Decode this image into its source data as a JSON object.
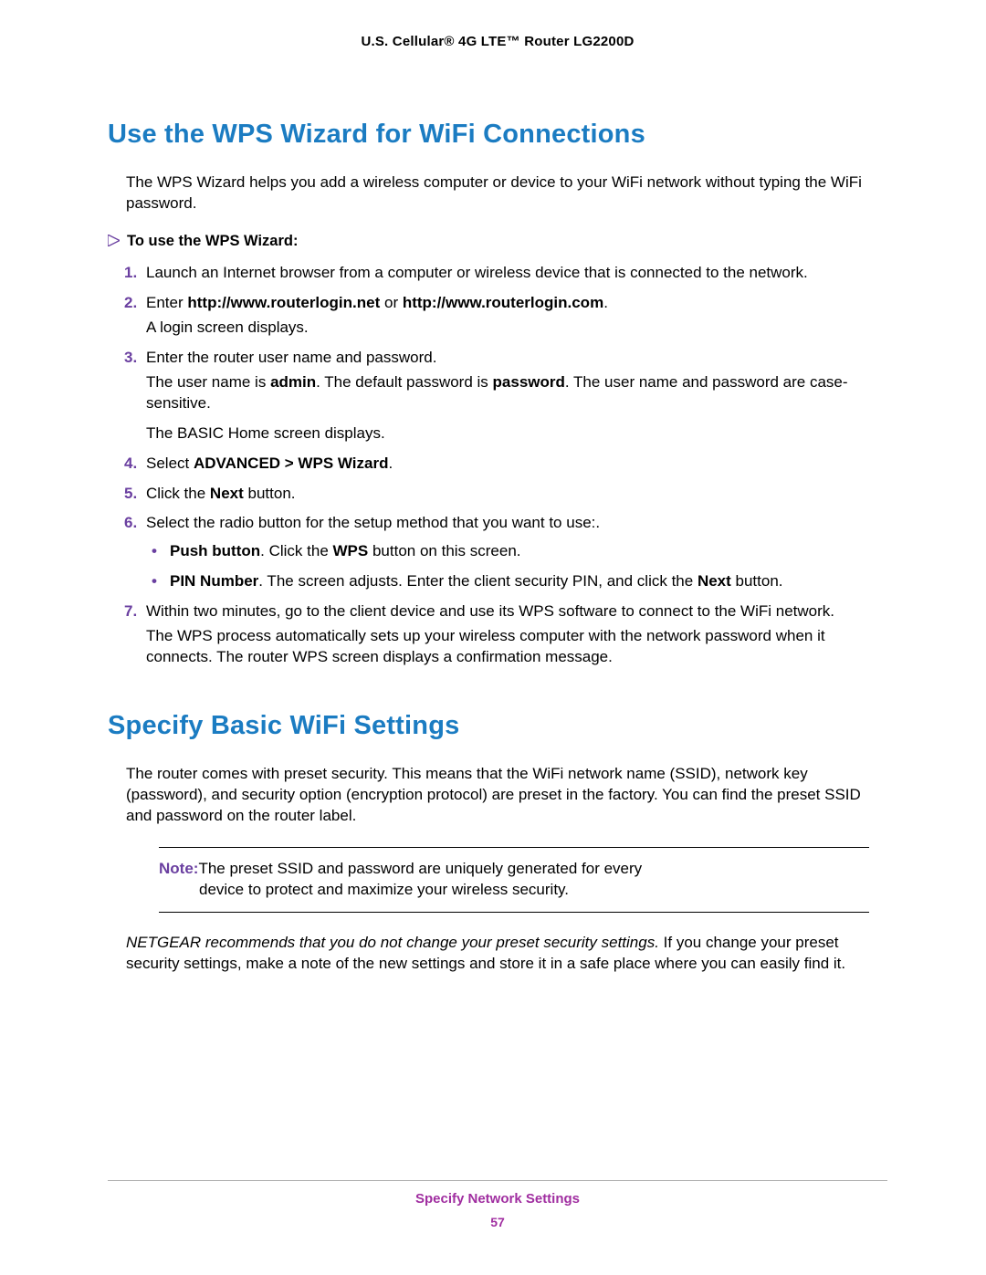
{
  "header": "U.S. Cellular® 4G LTE™ Router LG2200D",
  "section1": {
    "heading": "Use the WPS Wizard for WiFi Connections",
    "intro": "The WPS Wizard helps you add a wireless computer or device to your WiFi network without typing the WiFi password.",
    "taskTitle": "To use the WPS Wizard:",
    "steps": {
      "s1": "Launch an Internet browser from a computer or wireless device that is connected to the network.",
      "s2_pre": "Enter ",
      "s2_b1": "http://www.routerlogin.net",
      "s2_mid": " or ",
      "s2_b2": "http://www.routerlogin.com",
      "s2_post": ".",
      "s2_line2": "A login screen displays.",
      "s3": "Enter the router user name and password.",
      "s3_line2_pre": "The user name is ",
      "s3_line2_b1": "admin",
      "s3_line2_mid": ". The default password is ",
      "s3_line2_b2": "password",
      "s3_line2_post": ". The user name and password are case-sensitive.",
      "s3_line3": "The BASIC Home screen displays.",
      "s4_pre": "Select ",
      "s4_b": "ADVANCED > WPS Wizard",
      "s4_post": ".",
      "s5_pre": "Click the ",
      "s5_b": "Next",
      "s5_post": " button.",
      "s6": "Select the radio button for the setup method that you want to use:.",
      "s6_b1_pre": "Push button",
      "s6_b1_mid": ". Click the ",
      "s6_b1_b": "WPS",
      "s6_b1_post": " button on this screen.",
      "s6_b2_pre": "PIN Number",
      "s6_b2_mid": ". The screen adjusts. Enter the client security PIN, and click the ",
      "s6_b2_b": "Next",
      "s6_b2_post": " button.",
      "s7": "Within two minutes, go to the client device and use its WPS software to connect to the WiFi network.",
      "s7_line2": "The WPS process automatically sets up your wireless computer with the network password when it connects. The router WPS screen displays a confirmation message."
    }
  },
  "section2": {
    "heading": "Specify Basic WiFi Settings",
    "intro": "The router comes with preset security. This means that the WiFi network name (SSID), network key (password), and security option (encryption protocol) are preset in the factory. You can find the preset SSID and password on the router label.",
    "noteLabel": "Note:",
    "noteLine1": "The preset SSID and password are uniquely generated for every",
    "noteLine2": "device to protect and maximize your wireless security.",
    "recommend_italic": "NETGEAR recommends that you do not change your preset security settings.",
    "recommend_rest": " If you change your preset security settings, make a note of the new settings and store it in a safe place where you can easily find it."
  },
  "footer": {
    "chapter": "Specify Network Settings",
    "page": "57"
  }
}
